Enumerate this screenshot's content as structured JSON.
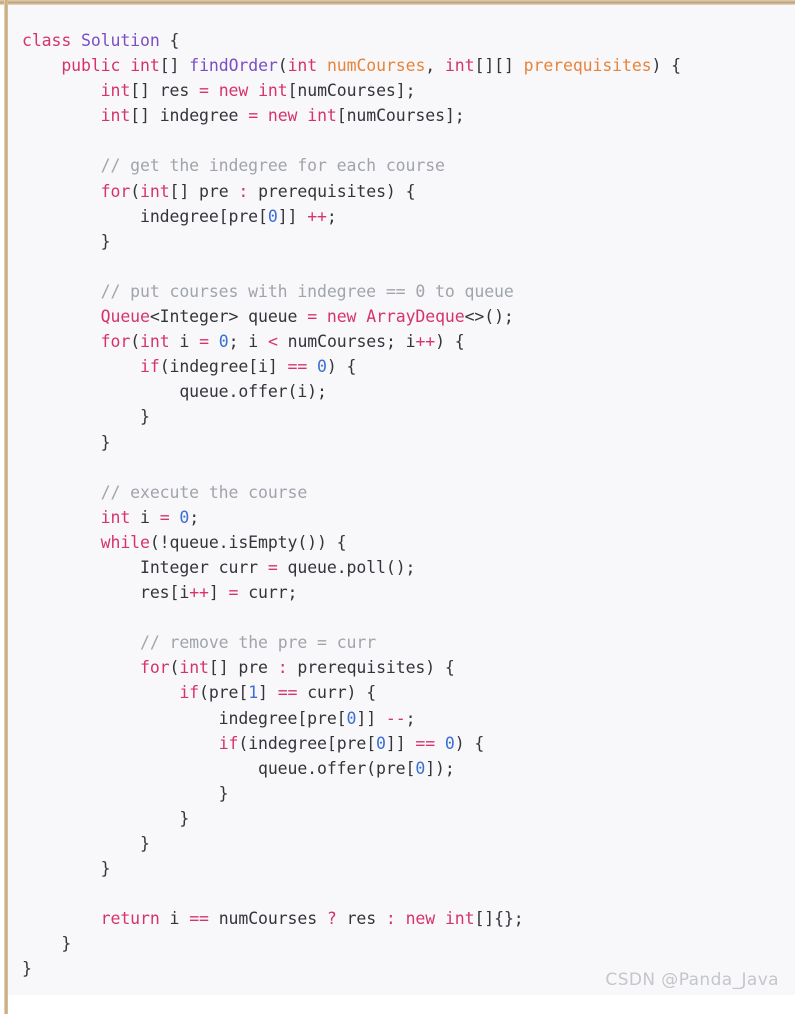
{
  "window": {
    "kind": "code-screenshot",
    "language": "Java",
    "background_color": "#f8f8fa",
    "page_background_color": "#ffffff",
    "accent_border_color": "#c2a071"
  },
  "theme": {
    "keyword_color": "#d6336c",
    "type_color": "#7b4ec4",
    "class_color": "#d6336c",
    "parameter_color": "#e8833a",
    "number_color": "#3b6fd4",
    "operator_color": "#d6336c",
    "comment_color": "#a0a4ab",
    "plain_color": "#33353a",
    "watermark_color": "#c3c6cb"
  },
  "code": {
    "plain_text": "class Solution {\n    public int[] findOrder(int numCourses, int[][] prerequisites) {\n        int[] res = new int[numCourses];\n        int[] indegree = new int[numCourses];\n\n        // get the indegree for each course\n        for(int[] pre : prerequisites) {\n            indegree[pre[0]] ++;\n        }\n\n        // put courses with indegree == 0 to queue\n        Queue<Integer> queue = new ArrayDeque<>();\n        for(int i = 0; i < numCourses; i++) {\n            if(indegree[i] == 0) {\n                queue.offer(i);\n            }\n        }\n\n        // execute the course\n        int i = 0;\n        while(!queue.isEmpty()) {\n            Integer curr = queue.poll();\n            res[i++] = curr;\n\n            // remove the pre = curr\n            for(int[] pre : prerequisites) {\n                if(pre[1] == curr) {\n                    indegree[pre[0]] --;\n                    if(indegree[pre[0]] == 0) {\n                        queue.offer(pre[0]);\n                    }\n                }\n            }\n        }\n\n        return i == numCourses ? res : new int[]{};\n    }\n}",
    "lines": [
      {
        "n": 1,
        "tokens": [
          {
            "t": "class",
            "c": "kw"
          },
          {
            "t": " ",
            "c": "pl"
          },
          {
            "t": "Solution",
            "c": "typ"
          },
          {
            "t": " {",
            "c": "pl"
          }
        ]
      },
      {
        "n": 2,
        "tokens": [
          {
            "t": "    ",
            "c": "pl"
          },
          {
            "t": "public",
            "c": "kw"
          },
          {
            "t": " ",
            "c": "pl"
          },
          {
            "t": "int",
            "c": "kw"
          },
          {
            "t": "[] ",
            "c": "pl"
          },
          {
            "t": "findOrder",
            "c": "typ"
          },
          {
            "t": "(",
            "c": "pl"
          },
          {
            "t": "int",
            "c": "kw"
          },
          {
            "t": " ",
            "c": "pl"
          },
          {
            "t": "numCourses",
            "c": "par"
          },
          {
            "t": ", ",
            "c": "pl"
          },
          {
            "t": "int",
            "c": "kw"
          },
          {
            "t": "[][] ",
            "c": "pl"
          },
          {
            "t": "prerequisites",
            "c": "par"
          },
          {
            "t": ") {",
            "c": "pl"
          }
        ]
      },
      {
        "n": 3,
        "tokens": [
          {
            "t": "        ",
            "c": "pl"
          },
          {
            "t": "int",
            "c": "kw"
          },
          {
            "t": "[] res ",
            "c": "pl"
          },
          {
            "t": "=",
            "c": "op"
          },
          {
            "t": " ",
            "c": "pl"
          },
          {
            "t": "new",
            "c": "kw"
          },
          {
            "t": " ",
            "c": "pl"
          },
          {
            "t": "int",
            "c": "kw"
          },
          {
            "t": "[numCourses];",
            "c": "pl"
          }
        ]
      },
      {
        "n": 4,
        "tokens": [
          {
            "t": "        ",
            "c": "pl"
          },
          {
            "t": "int",
            "c": "kw"
          },
          {
            "t": "[] indegree ",
            "c": "pl"
          },
          {
            "t": "=",
            "c": "op"
          },
          {
            "t": " ",
            "c": "pl"
          },
          {
            "t": "new",
            "c": "kw"
          },
          {
            "t": " ",
            "c": "pl"
          },
          {
            "t": "int",
            "c": "kw"
          },
          {
            "t": "[numCourses];",
            "c": "pl"
          }
        ]
      },
      {
        "n": 5,
        "tokens": []
      },
      {
        "n": 6,
        "tokens": [
          {
            "t": "        ",
            "c": "pl"
          },
          {
            "t": "// get the indegree for each course",
            "c": "cmt"
          }
        ]
      },
      {
        "n": 7,
        "tokens": [
          {
            "t": "        ",
            "c": "pl"
          },
          {
            "t": "for",
            "c": "kw"
          },
          {
            "t": "(",
            "c": "pl"
          },
          {
            "t": "int",
            "c": "kw"
          },
          {
            "t": "[] pre ",
            "c": "pl"
          },
          {
            "t": ":",
            "c": "op"
          },
          {
            "t": " prerequisites) {",
            "c": "pl"
          }
        ]
      },
      {
        "n": 8,
        "tokens": [
          {
            "t": "            indegree[pre[",
            "c": "pl"
          },
          {
            "t": "0",
            "c": "num"
          },
          {
            "t": "]] ",
            "c": "pl"
          },
          {
            "t": "++",
            "c": "op"
          },
          {
            "t": ";",
            "c": "pl"
          }
        ]
      },
      {
        "n": 9,
        "tokens": [
          {
            "t": "        }",
            "c": "pl"
          }
        ]
      },
      {
        "n": 10,
        "tokens": []
      },
      {
        "n": 11,
        "tokens": [
          {
            "t": "        ",
            "c": "pl"
          },
          {
            "t": "// put courses with indegree == 0 to queue",
            "c": "cmt"
          }
        ]
      },
      {
        "n": 12,
        "tokens": [
          {
            "t": "        ",
            "c": "pl"
          },
          {
            "t": "Queue",
            "c": "cls"
          },
          {
            "t": "<Integer> queue ",
            "c": "pl"
          },
          {
            "t": "=",
            "c": "op"
          },
          {
            "t": " ",
            "c": "pl"
          },
          {
            "t": "new",
            "c": "kw"
          },
          {
            "t": " ",
            "c": "pl"
          },
          {
            "t": "ArrayDeque",
            "c": "cls"
          },
          {
            "t": "<>();",
            "c": "pl"
          }
        ]
      },
      {
        "n": 13,
        "tokens": [
          {
            "t": "        ",
            "c": "pl"
          },
          {
            "t": "for",
            "c": "kw"
          },
          {
            "t": "(",
            "c": "pl"
          },
          {
            "t": "int",
            "c": "kw"
          },
          {
            "t": " i ",
            "c": "pl"
          },
          {
            "t": "=",
            "c": "op"
          },
          {
            "t": " ",
            "c": "pl"
          },
          {
            "t": "0",
            "c": "num"
          },
          {
            "t": "; i ",
            "c": "pl"
          },
          {
            "t": "<",
            "c": "op"
          },
          {
            "t": " numCourses; i",
            "c": "pl"
          },
          {
            "t": "++",
            "c": "op"
          },
          {
            "t": ") {",
            "c": "pl"
          }
        ]
      },
      {
        "n": 14,
        "tokens": [
          {
            "t": "            ",
            "c": "pl"
          },
          {
            "t": "if",
            "c": "kw"
          },
          {
            "t": "(indegree[i] ",
            "c": "pl"
          },
          {
            "t": "==",
            "c": "op"
          },
          {
            "t": " ",
            "c": "pl"
          },
          {
            "t": "0",
            "c": "num"
          },
          {
            "t": ") {",
            "c": "pl"
          }
        ]
      },
      {
        "n": 15,
        "tokens": [
          {
            "t": "                queue.offer(i);",
            "c": "pl"
          }
        ]
      },
      {
        "n": 16,
        "tokens": [
          {
            "t": "            }",
            "c": "pl"
          }
        ]
      },
      {
        "n": 17,
        "tokens": [
          {
            "t": "        }",
            "c": "pl"
          }
        ]
      },
      {
        "n": 18,
        "tokens": []
      },
      {
        "n": 19,
        "tokens": [
          {
            "t": "        ",
            "c": "pl"
          },
          {
            "t": "// execute the course",
            "c": "cmt"
          }
        ]
      },
      {
        "n": 20,
        "tokens": [
          {
            "t": "        ",
            "c": "pl"
          },
          {
            "t": "int",
            "c": "kw"
          },
          {
            "t": " i ",
            "c": "pl"
          },
          {
            "t": "=",
            "c": "op"
          },
          {
            "t": " ",
            "c": "pl"
          },
          {
            "t": "0",
            "c": "num"
          },
          {
            "t": ";",
            "c": "pl"
          }
        ]
      },
      {
        "n": 21,
        "tokens": [
          {
            "t": "        ",
            "c": "pl"
          },
          {
            "t": "while",
            "c": "kw"
          },
          {
            "t": "(!queue.isEmpty()) {",
            "c": "pl"
          }
        ]
      },
      {
        "n": 22,
        "tokens": [
          {
            "t": "            Integer curr ",
            "c": "pl"
          },
          {
            "t": "=",
            "c": "op"
          },
          {
            "t": " queue.poll();",
            "c": "pl"
          }
        ]
      },
      {
        "n": 23,
        "tokens": [
          {
            "t": "            res[i",
            "c": "pl"
          },
          {
            "t": "++",
            "c": "op"
          },
          {
            "t": "] ",
            "c": "pl"
          },
          {
            "t": "=",
            "c": "op"
          },
          {
            "t": " curr;",
            "c": "pl"
          }
        ]
      },
      {
        "n": 24,
        "tokens": []
      },
      {
        "n": 25,
        "tokens": [
          {
            "t": "            ",
            "c": "pl"
          },
          {
            "t": "// remove the pre = curr",
            "c": "cmt"
          }
        ]
      },
      {
        "n": 26,
        "tokens": [
          {
            "t": "            ",
            "c": "pl"
          },
          {
            "t": "for",
            "c": "kw"
          },
          {
            "t": "(",
            "c": "pl"
          },
          {
            "t": "int",
            "c": "kw"
          },
          {
            "t": "[] pre ",
            "c": "pl"
          },
          {
            "t": ":",
            "c": "op"
          },
          {
            "t": " prerequisites) {",
            "c": "pl"
          }
        ]
      },
      {
        "n": 27,
        "tokens": [
          {
            "t": "                ",
            "c": "pl"
          },
          {
            "t": "if",
            "c": "kw"
          },
          {
            "t": "(pre[",
            "c": "pl"
          },
          {
            "t": "1",
            "c": "num"
          },
          {
            "t": "] ",
            "c": "pl"
          },
          {
            "t": "==",
            "c": "op"
          },
          {
            "t": " curr) {",
            "c": "pl"
          }
        ]
      },
      {
        "n": 28,
        "tokens": [
          {
            "t": "                    indegree[pre[",
            "c": "pl"
          },
          {
            "t": "0",
            "c": "num"
          },
          {
            "t": "]] ",
            "c": "pl"
          },
          {
            "t": "--",
            "c": "op"
          },
          {
            "t": ";",
            "c": "pl"
          }
        ]
      },
      {
        "n": 29,
        "tokens": [
          {
            "t": "                    ",
            "c": "pl"
          },
          {
            "t": "if",
            "c": "kw"
          },
          {
            "t": "(indegree[pre[",
            "c": "pl"
          },
          {
            "t": "0",
            "c": "num"
          },
          {
            "t": "]] ",
            "c": "pl"
          },
          {
            "t": "==",
            "c": "op"
          },
          {
            "t": " ",
            "c": "pl"
          },
          {
            "t": "0",
            "c": "num"
          },
          {
            "t": ") {",
            "c": "pl"
          }
        ]
      },
      {
        "n": 30,
        "tokens": [
          {
            "t": "                        queue.offer(pre[",
            "c": "pl"
          },
          {
            "t": "0",
            "c": "num"
          },
          {
            "t": "]);",
            "c": "pl"
          }
        ]
      },
      {
        "n": 31,
        "tokens": [
          {
            "t": "                    }",
            "c": "pl"
          }
        ]
      },
      {
        "n": 32,
        "tokens": [
          {
            "t": "                }",
            "c": "pl"
          }
        ]
      },
      {
        "n": 33,
        "tokens": [
          {
            "t": "            }",
            "c": "pl"
          }
        ]
      },
      {
        "n": 34,
        "tokens": [
          {
            "t": "        }",
            "c": "pl"
          }
        ]
      },
      {
        "n": 35,
        "tokens": []
      },
      {
        "n": 36,
        "tokens": [
          {
            "t": "        ",
            "c": "pl"
          },
          {
            "t": "return",
            "c": "kw"
          },
          {
            "t": " i ",
            "c": "pl"
          },
          {
            "t": "==",
            "c": "op"
          },
          {
            "t": " numCourses ",
            "c": "pl"
          },
          {
            "t": "?",
            "c": "op"
          },
          {
            "t": " res ",
            "c": "pl"
          },
          {
            "t": ":",
            "c": "op"
          },
          {
            "t": " ",
            "c": "pl"
          },
          {
            "t": "new",
            "c": "kw"
          },
          {
            "t": " ",
            "c": "pl"
          },
          {
            "t": "int",
            "c": "kw"
          },
          {
            "t": "[]{};",
            "c": "pl"
          }
        ]
      },
      {
        "n": 37,
        "tokens": [
          {
            "t": "    }",
            "c": "pl"
          }
        ]
      },
      {
        "n": 38,
        "tokens": [
          {
            "t": "}",
            "c": "pl"
          }
        ]
      }
    ]
  },
  "watermark": {
    "text": "CSDN @Panda_Java"
  }
}
